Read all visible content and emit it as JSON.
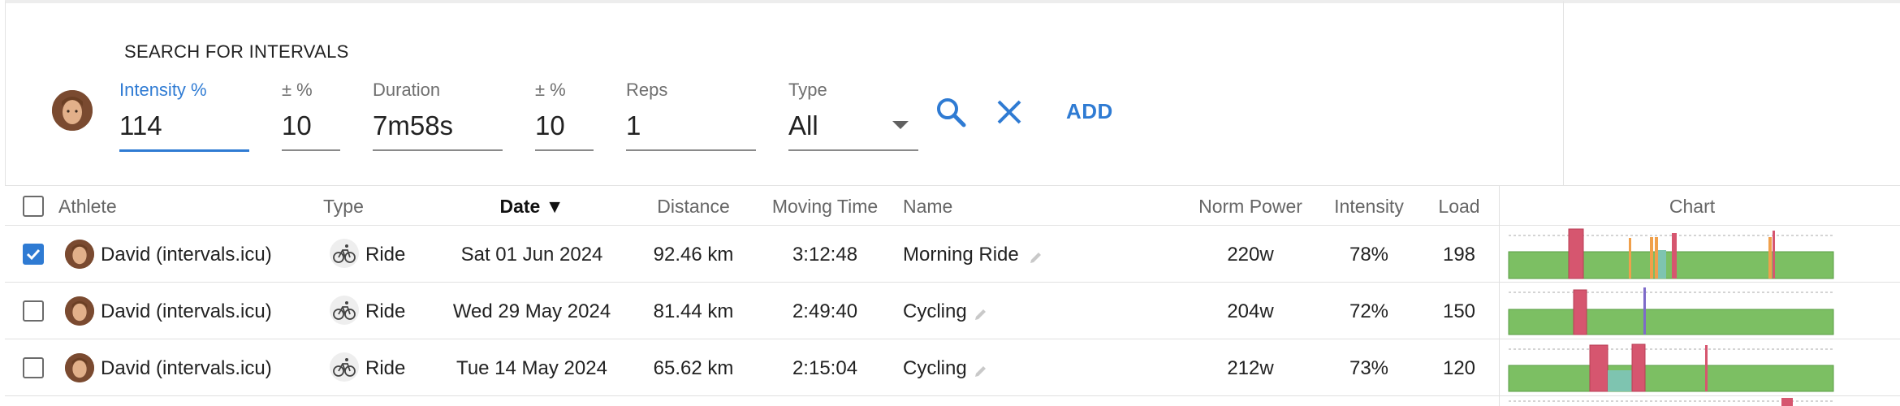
{
  "search": {
    "title": "SEARCH FOR INTERVALS",
    "fields": {
      "intensity": {
        "label": "Intensity %",
        "value": "114"
      },
      "intensity_tol": {
        "label": "± %",
        "value": "10"
      },
      "duration": {
        "label": "Duration",
        "value": "7m58s"
      },
      "duration_tol": {
        "label": "± %",
        "value": "10"
      },
      "reps": {
        "label": "Reps",
        "value": "1"
      },
      "type": {
        "label": "Type",
        "value": "All"
      }
    },
    "add_label": "ADD",
    "accent_color": "#2f7bd3"
  },
  "table": {
    "headers": {
      "athlete": "Athlete",
      "type": "Type",
      "date": "Date ▼",
      "distance": "Distance",
      "moving_time": "Moving Time",
      "name": "Name",
      "norm_power": "Norm Power",
      "intensity": "Intensity",
      "load": "Load",
      "chart": "Chart"
    },
    "rows": [
      {
        "checked": true,
        "athlete": "David (intervals.icu)",
        "type": "Ride",
        "date": "Sat 01 Jun 2024",
        "distance": "92.46 km",
        "moving_time": "3:12:48",
        "name": "Morning Ride",
        "norm_power": "220w",
        "intensity": "78%",
        "load": "198"
      },
      {
        "checked": false,
        "athlete": "David (intervals.icu)",
        "type": "Ride",
        "date": "Wed 29 May 2024",
        "distance": "81.44 km",
        "moving_time": "2:49:40",
        "name": "Cycling",
        "norm_power": "204w",
        "intensity": "72%",
        "load": "150"
      },
      {
        "checked": false,
        "athlete": "David (intervals.icu)",
        "type": "Ride",
        "date": "Tue 14 May 2024",
        "distance": "65.62 km",
        "moving_time": "2:15:04",
        "name": "Cycling",
        "norm_power": "212w",
        "intensity": "73%",
        "load": "120"
      }
    ]
  },
  "icons": [
    "search-icon",
    "close-icon",
    "bike-icon",
    "pencil-icon",
    "chevron-down-icon"
  ],
  "colors": {
    "zone_green": "#7cbf63",
    "zone_red": "#d6566f",
    "zone_orange": "#f0a04b",
    "zone_teal": "#7ec4b0",
    "zone_purple": "#7e6bc9"
  }
}
